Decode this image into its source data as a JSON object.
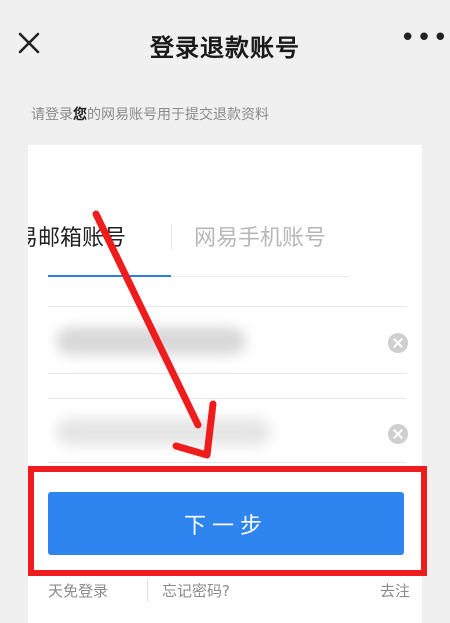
{
  "header": {
    "title": "登录退款账号",
    "close_icon": "close-icon",
    "more_icon": "more-horizontal-icon",
    "more_text": "•••"
  },
  "subtitle": {
    "before": "请登录",
    "bold": "您",
    "after": "的网易账号用于提交退款资料"
  },
  "tabs": [
    {
      "label": "易邮箱账号",
      "active": true
    },
    {
      "label": "网易手机账号",
      "active": false
    }
  ],
  "primary_button": {
    "label": "下一步"
  },
  "links": {
    "left": "天免登录",
    "middle": "忘记密码?",
    "right": "去注"
  },
  "colors": {
    "accent": "#2f85f0",
    "annotation_red": "#ee1c1c"
  }
}
